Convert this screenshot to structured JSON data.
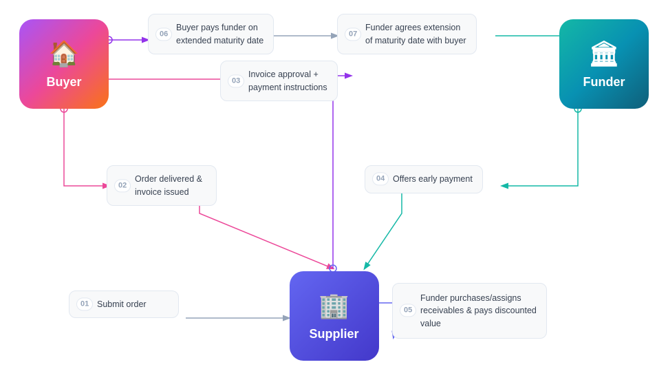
{
  "actors": {
    "buyer": {
      "label": "Buyer",
      "icon": "🏠"
    },
    "funder": {
      "label": "Funder",
      "icon": "🏛"
    },
    "supplier": {
      "label": "Supplier",
      "icon": "🏢"
    }
  },
  "steps": [
    {
      "number": "01",
      "text": "Submit order"
    },
    {
      "number": "02",
      "text": "Order delivered &\ninvoice issued"
    },
    {
      "number": "03",
      "text": "Invoice approval +\npayment instructions"
    },
    {
      "number": "04",
      "text": "Offers early payment"
    },
    {
      "number": "05",
      "text": "Funder purchases/assigns\nreceivables & pays discounted\nvalue"
    },
    {
      "number": "06",
      "text": "Buyer pays funder on\nextended maturity date"
    },
    {
      "number": "07",
      "text": "Funder agrees extension\nof maturity date with buyer"
    }
  ]
}
